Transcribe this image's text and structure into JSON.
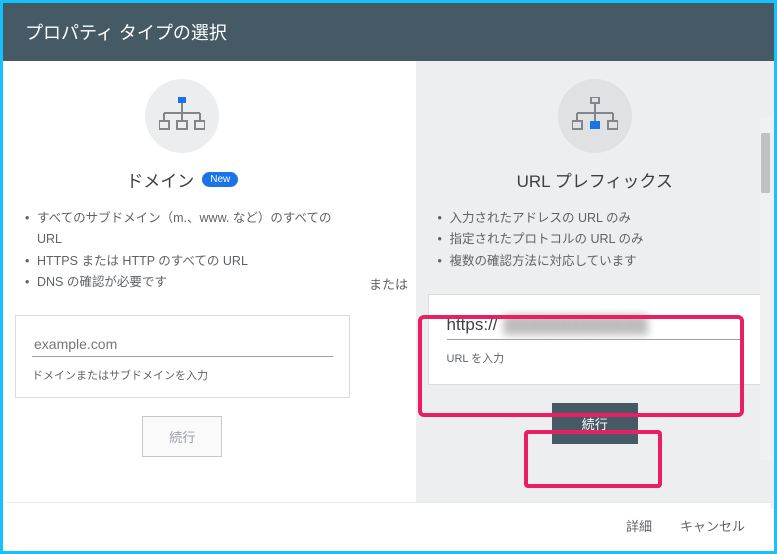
{
  "header": {
    "title": "プロパティ タイプの選択"
  },
  "separator": "または",
  "domain_card": {
    "title": "ドメイン",
    "badge": "New",
    "bullets": [
      "すべてのサブドメイン（m.、www. など）のすべての URL",
      "HTTPS または HTTP のすべての URL",
      "DNS の確認が必要です"
    ],
    "placeholder": "example.com",
    "hint": "ドメインまたはサブドメインを入力",
    "continue": "続行"
  },
  "url_card": {
    "title": "URL プレフィックス",
    "bullets": [
      "入力されたアドレスの URL のみ",
      "指定されたプロトコルの URL のみ",
      "複数の確認方法に対応しています"
    ],
    "value": "https://",
    "hint": "URL を入力",
    "continue": "続行"
  },
  "footer": {
    "details": "詳細",
    "cancel": "キャンセル"
  }
}
